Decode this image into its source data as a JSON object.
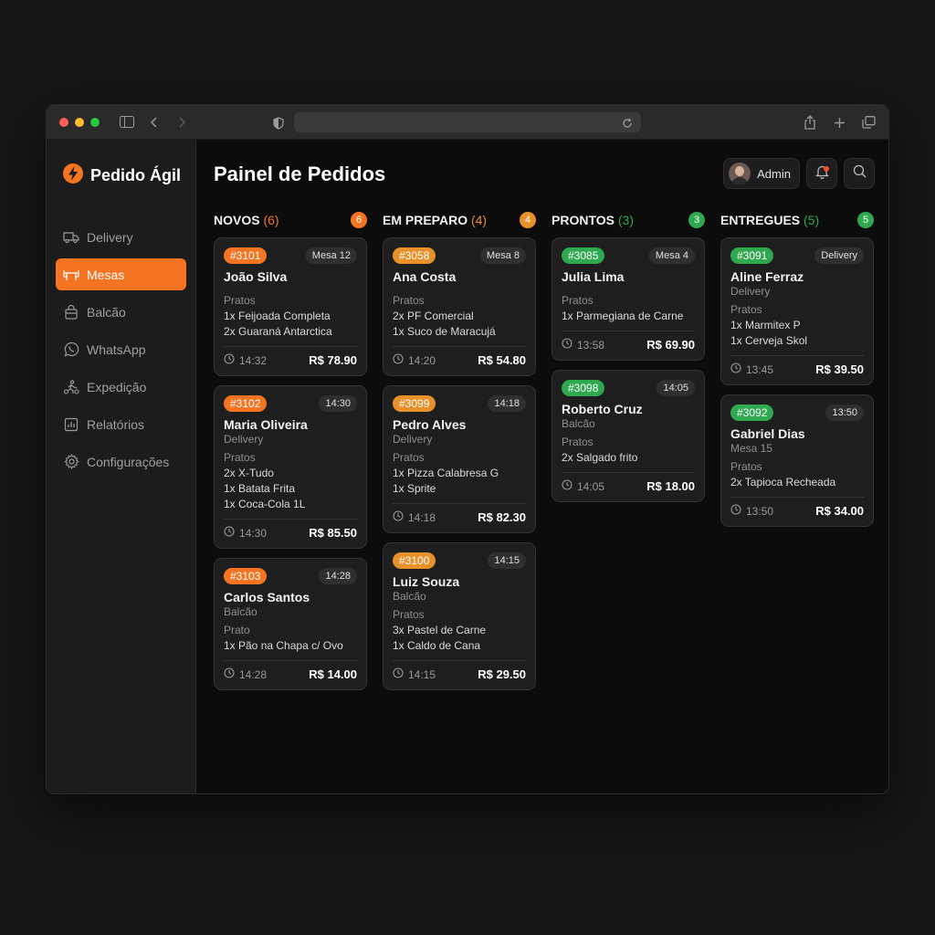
{
  "colors": {
    "accent": "#f47421",
    "novos": "#f47421",
    "preparo": "#e8912a",
    "prontos": "#2fa84f",
    "entregues": "#2fa84f"
  },
  "app": {
    "name": "Pedido Ágil",
    "logo_icon": "bolt-logo-icon"
  },
  "sidebar": {
    "items": [
      {
        "label": "Delivery",
        "icon": "truck-icon"
      },
      {
        "label": "Mesas",
        "icon": "table-icon",
        "active": true
      },
      {
        "label": "Balcão",
        "icon": "bag-icon"
      },
      {
        "label": "WhatsApp",
        "icon": "whatsapp-icon"
      },
      {
        "label": "Expedição",
        "icon": "dispatch-icon"
      },
      {
        "label": "Relatórios",
        "icon": "chart-icon"
      },
      {
        "label": "Configurações",
        "icon": "gear-icon"
      }
    ]
  },
  "header": {
    "title": "Painel de Pedidos",
    "user": "Admin"
  },
  "columns": [
    {
      "title": "NOVOS",
      "count": "(6)",
      "badge": "6",
      "cards": [
        {
          "id": "#3101",
          "tag": "Mesa 12",
          "customer": "João Silva",
          "sub": "",
          "section": "Pratos",
          "items": [
            "1x Feijoada Completa",
            "2x Guaraná Antarctica"
          ],
          "time": "14:32",
          "price": "R$ 78.90"
        },
        {
          "id": "#3102",
          "tag": "14:30",
          "customer": "Maria Oliveira",
          "sub": "Delivery",
          "section": "Pratos",
          "items": [
            "2x X-Tudo",
            "1x Batata Frita",
            "1x Coca-Cola 1L"
          ],
          "time": "14:30",
          "price": "R$ 85.50"
        },
        {
          "id": "#3103",
          "tag": "14:28",
          "customer": "Carlos Santos",
          "sub": "Balcão",
          "section": "Prato",
          "items": [
            "1x Pão na Chapa c/ Ovo"
          ],
          "time": "14:28",
          "price": "R$ 14.00"
        }
      ]
    },
    {
      "title": "EM PREPARO",
      "count": "(4)",
      "badge": "4",
      "cards": [
        {
          "id": "#3058",
          "tag": "Mesa 8",
          "customer": "Ana Costa",
          "sub": "",
          "section": "Pratos",
          "items": [
            "2x PF Comercial",
            "1x Suco de Maracujá"
          ],
          "time": "14:20",
          "price": "R$ 54.80"
        },
        {
          "id": "#3099",
          "tag": "14:18",
          "customer": "Pedro Alves",
          "sub": "Delivery",
          "section": "Pratos",
          "items": [
            "1x Pizza Calabresa G",
            "1x Sprite"
          ],
          "time": "14:18",
          "price": "R$ 82.30"
        },
        {
          "id": "#3100",
          "tag": "14:15",
          "customer": "Luiz Souza",
          "sub": "Balcão",
          "section": "Pratos",
          "items": [
            "3x Pastel de Carne",
            "1x Caldo de Cana"
          ],
          "time": "14:15",
          "price": "R$ 29.50"
        }
      ]
    },
    {
      "title": "PRONTOS",
      "count": "(3)",
      "badge": "3",
      "cards": [
        {
          "id": "#3085",
          "tag": "Mesa 4",
          "customer": "Julia Lima",
          "sub": "",
          "section": "Pratos",
          "items": [
            "1x Parmegiana de Carne"
          ],
          "time": "13:58",
          "price": "R$ 69.90"
        },
        {
          "id": "#3098",
          "tag": "14:05",
          "customer": "Roberto Cruz",
          "sub": "Balcão",
          "section": "Pratos",
          "items": [
            "2x Salgado frito"
          ],
          "time": "14:05",
          "price": "R$ 18.00"
        }
      ]
    },
    {
      "title": "ENTREGUES",
      "count": "(5)",
      "badge": "5",
      "cards": [
        {
          "id": "#3091",
          "tag": "Delivery",
          "customer": "Aline Ferraz",
          "sub": "Delivery",
          "section": "Pratos",
          "items": [
            "1x Marmitex P",
            "1x Cerveja Skol"
          ],
          "time": "13:45",
          "price": "R$ 39.50"
        },
        {
          "id": "#3092",
          "tag": "13:50",
          "customer": "Gabriel Dias",
          "sub": "Mesa 15",
          "section": "Pratos",
          "items": [
            "2x Tapioca Recheada"
          ],
          "time": "13:50",
          "price": "R$ 34.00"
        }
      ]
    }
  ]
}
